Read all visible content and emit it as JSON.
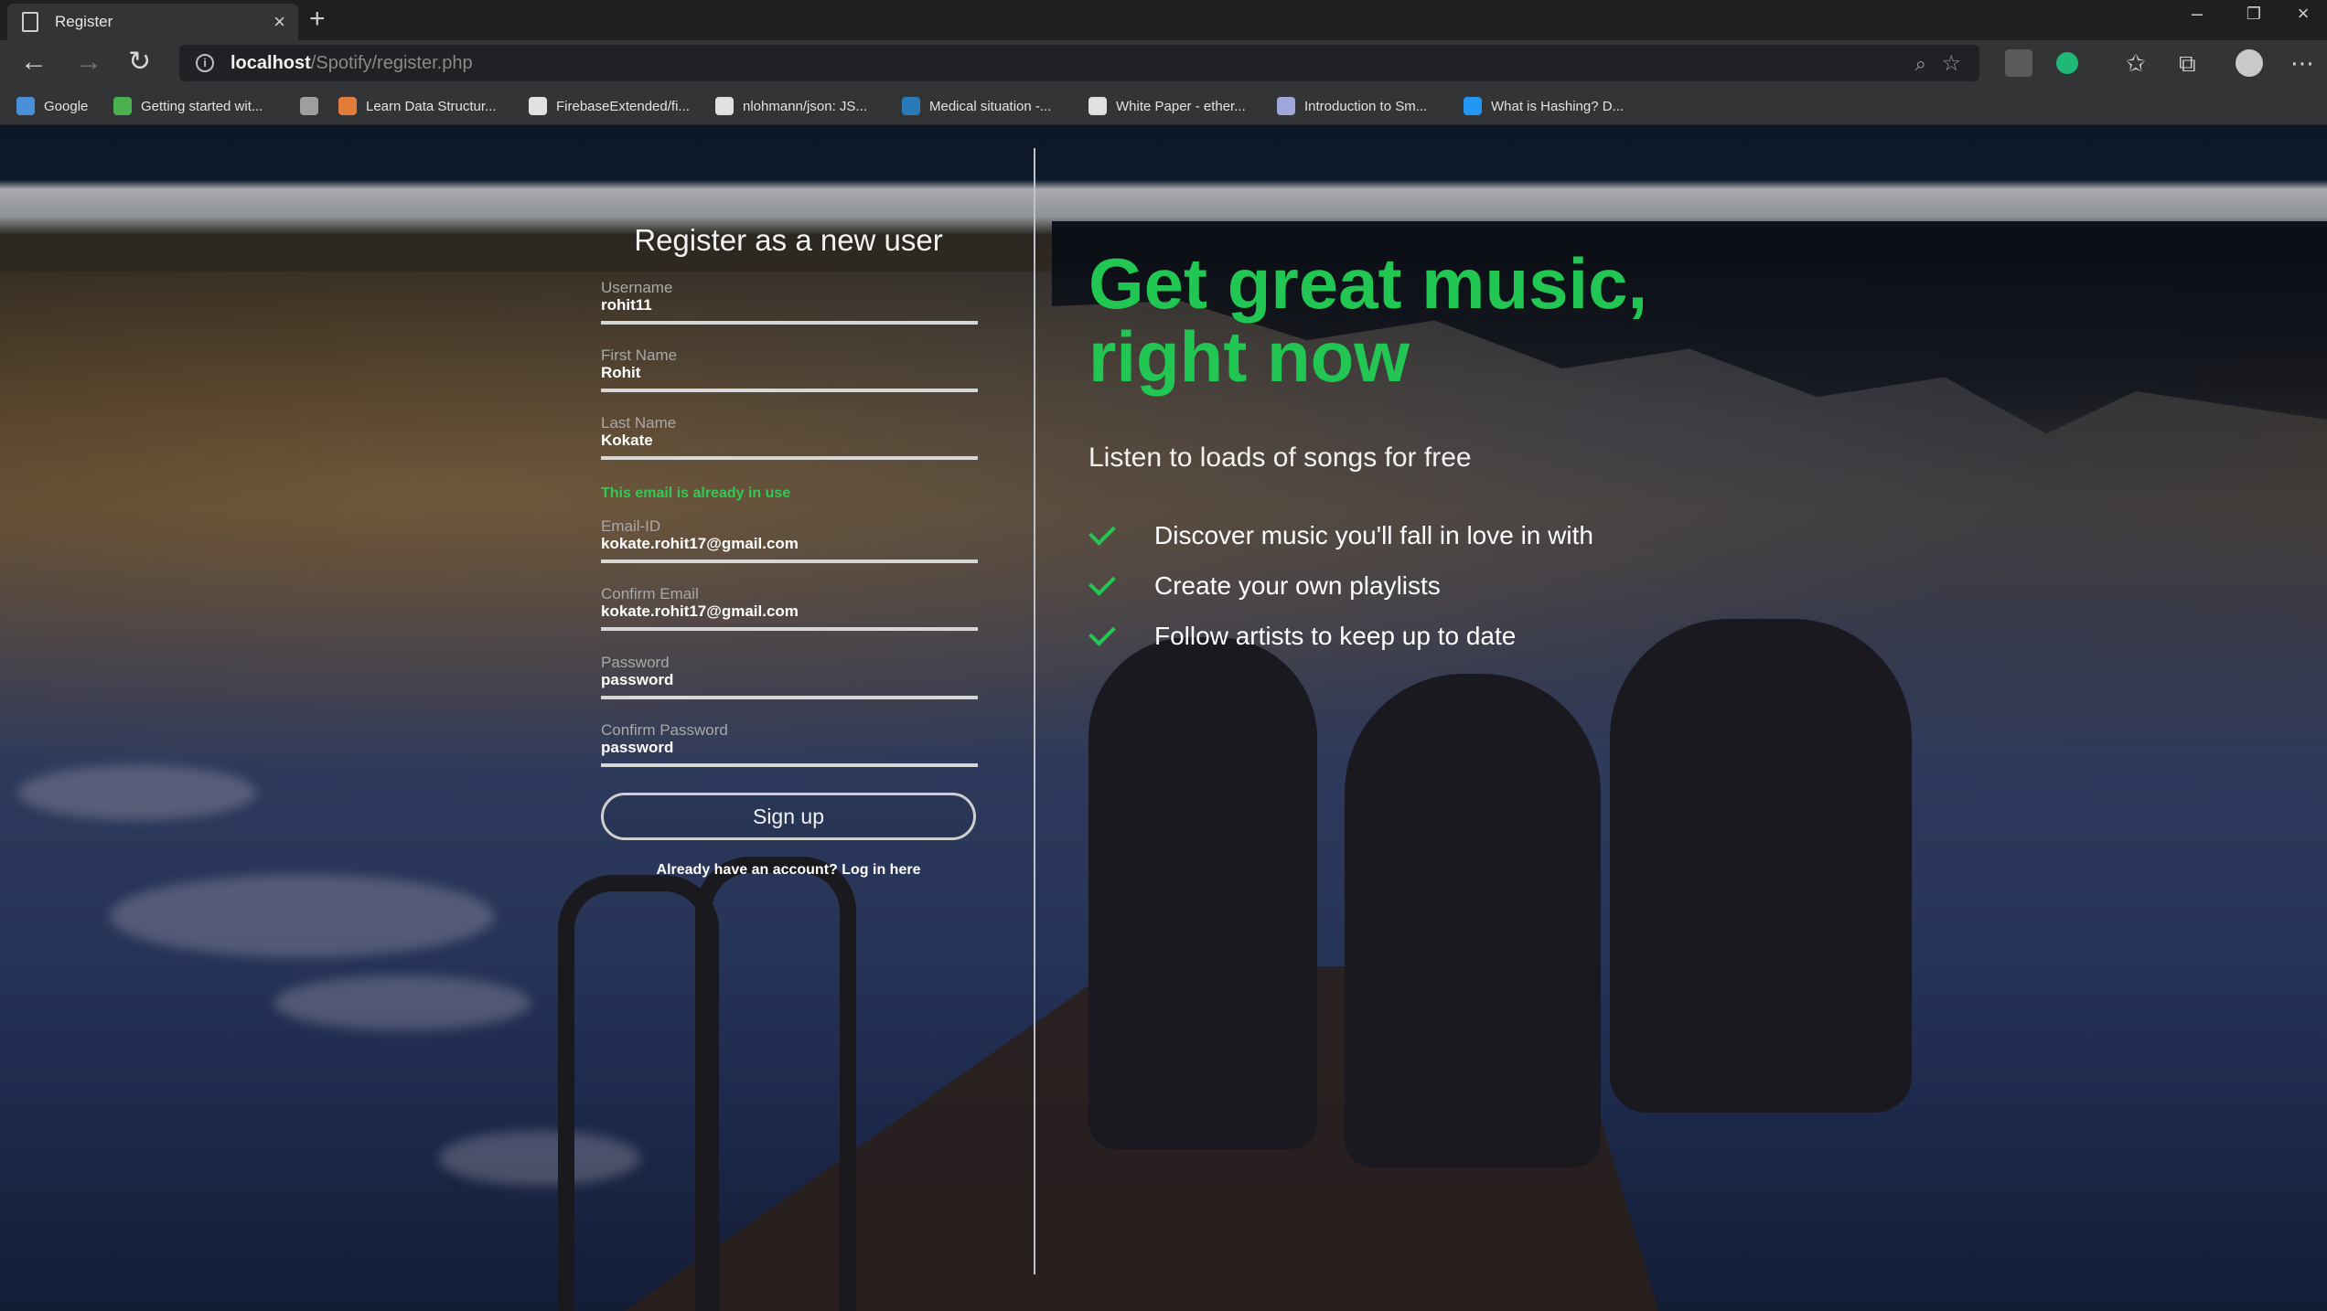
{
  "browser": {
    "tab_title": "Register",
    "tab_close": "×",
    "new_tab": "+",
    "url_host": "localhost",
    "url_path": "/Spotify/register.php",
    "window_controls": {
      "minimize": "–",
      "restore": "❐",
      "close": "×"
    },
    "bookmarks": [
      {
        "label": "Google",
        "icon": "google-icon",
        "color": "#4a90d9"
      },
      {
        "label": "Getting started wit...",
        "icon": "leaf-icon",
        "color": "#4caf50"
      },
      {
        "label": "",
        "icon": "page-icon",
        "color": "#9e9e9e"
      },
      {
        "label": "Learn Data Structur...",
        "icon": "bookmark-icon",
        "color": "#e07b39"
      },
      {
        "label": "FirebaseExtended/fi...",
        "icon": "github-icon",
        "color": "#e0e0e0"
      },
      {
        "label": "nlohmann/json: JS...",
        "icon": "github-icon",
        "color": "#e0e0e0"
      },
      {
        "label": "Medical situation -...",
        "icon": "linkedin-icon",
        "color": "#2a7ab8"
      },
      {
        "label": "White Paper - ether...",
        "icon": "github-icon",
        "color": "#e0e0e0"
      },
      {
        "label": "Introduction to Sm...",
        "icon": "doc-icon",
        "color": "#9fa8da"
      },
      {
        "label": "What is Hashing? D...",
        "icon": "globe-icon",
        "color": "#2196f3"
      }
    ]
  },
  "form": {
    "title": "Register as a new user",
    "fields": [
      {
        "label": "Username",
        "value": "rohit11"
      },
      {
        "label": "First Name",
        "value": "Rohit"
      },
      {
        "label": "Last Name",
        "value": "Kokate"
      },
      {
        "label": "Email-ID",
        "value": "kokate.rohit17@gmail.com"
      },
      {
        "label": "Confirm Email",
        "value": "kokate.rohit17@gmail.com"
      },
      {
        "label": "Password",
        "value": "password"
      },
      {
        "label": "Confirm Password",
        "value": "password"
      }
    ],
    "error": "This email is already in use",
    "submit_label": "Sign up",
    "login_link": "Already have an account? Log in here"
  },
  "promo": {
    "headline_line1": "Get great music,",
    "headline_line2": "right now",
    "subtitle": "Listen to loads of songs for free",
    "features": [
      "Discover music you'll fall in love in with",
      "Create your own playlists",
      "Follow artists to keep up to date"
    ]
  },
  "colors": {
    "accent": "#22c653",
    "error": "#2ecc52"
  }
}
